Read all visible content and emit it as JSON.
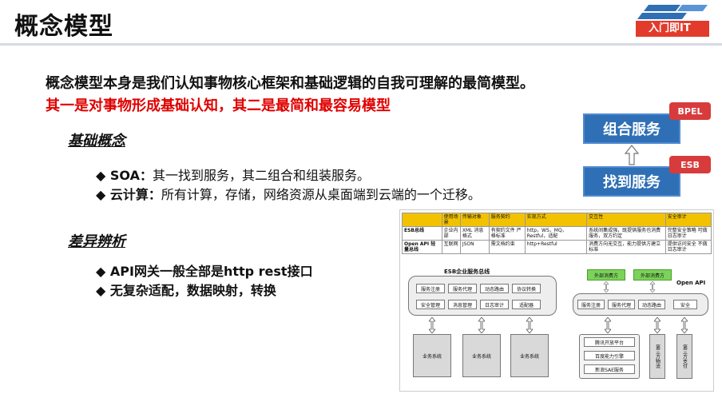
{
  "slide": {
    "title": "概念模型",
    "logo_text": "入门即IT",
    "main_text": "概念模型本身是我们认知事物核心框架和基础逻辑的自我可理解的最简模型。",
    "sub_text": "其一是对事物形成基础认知，其二是最简和最容易模型"
  },
  "section1": {
    "heading": "基础概念",
    "bullets": [
      {
        "marker": "◆",
        "label": "SOA：",
        "text": "其一找到服务，其二组合和组装服务。"
      },
      {
        "marker": "◆",
        "label": "云计算：",
        "text": "所有计算，存储，网络资源从桌面端到云端的一个迁移。"
      }
    ]
  },
  "section2": {
    "heading": "差异辨析",
    "bullets": [
      {
        "marker": "◆",
        "text": "API网关一般全部是http rest接口"
      },
      {
        "marker": "◆",
        "text": "无复杂适配，数据映射，转换"
      }
    ]
  },
  "services": {
    "compose": "组合服务",
    "find": "找到服务",
    "tag_compose": "BPEL",
    "tag_find": "ESB"
  },
  "diagram": {
    "table": {
      "headers": [
        "",
        "使用场景",
        "传输对象",
        "服务契约",
        "实现方式",
        "交互性",
        "安全审计"
      ],
      "rows": [
        [
          "ESB总线",
          "企业内部",
          "XML 消息格式",
          "有契约文件 严格标准",
          "http，WS，MQ，Restful，适配",
          "系统间集成强，既提供服务也消费服务，双方约定",
          "完整安全策略 可做日志审计"
        ],
        [
          "Open API 轻量总线",
          "互联网",
          "JSON",
          "需文档约束",
          "http+Restful",
          "消费方向无交互，能力提供方建立标准",
          "提供访问安全 不做日志审计"
        ]
      ]
    },
    "esb": {
      "title": "ESB企业服务总线",
      "cells": [
        "服务注册",
        "服务代理",
        "动态路由",
        "协议转换",
        "安全管理",
        "消息管理",
        "日志审计",
        "适配器"
      ],
      "systems": [
        "业务系统",
        "业务系统",
        "业务系统"
      ]
    },
    "openapi": {
      "title": "Open API",
      "consumers": [
        "外部消费方",
        "外部消费方"
      ],
      "cells": [
        "服务注册",
        "服务代理",
        "动态路由",
        "安全"
      ],
      "providers": [
        "腾讯开放平台",
        "百度能力引擎",
        "新浪SAE服务"
      ],
      "third_party": [
        "第三方物流",
        "第三方支付"
      ]
    }
  }
}
